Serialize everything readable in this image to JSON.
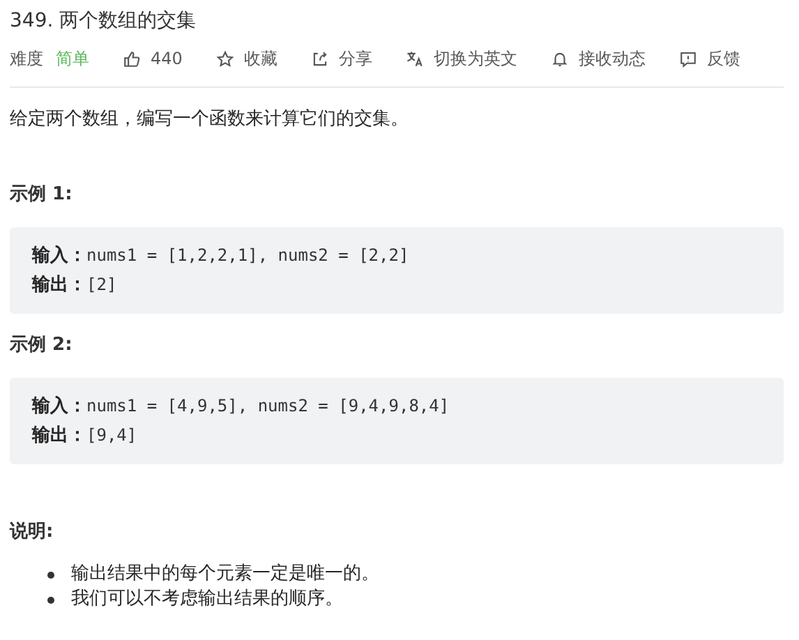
{
  "title": "349. 两个数组的交集",
  "meta": {
    "difficulty_label": "难度",
    "difficulty": {
      "text": "简单",
      "kind": "easy"
    },
    "actions": [
      {
        "kind": "like",
        "label": "440"
      },
      {
        "kind": "star",
        "label": "收藏"
      },
      {
        "kind": "share",
        "label": "分享"
      },
      {
        "kind": "translate",
        "label": "切换为英文"
      },
      {
        "kind": "bell",
        "label": "接收动态"
      },
      {
        "kind": "feedback",
        "label": "反馈"
      }
    ]
  },
  "description": "给定两个数组，编写一个函数来计算它们的交集。",
  "examples": [
    {
      "heading": "示例 1:",
      "lines": [
        {
          "label": "输入：",
          "code": "nums1 = [1,2,2,1], nums2 = [2,2]"
        },
        {
          "label": "输出：",
          "code": "[2]"
        }
      ]
    },
    {
      "heading": "示例 2:",
      "lines": [
        {
          "label": "输入：",
          "code": "nums1 = [4,9,5], nums2 = [9,4,9,8,4]"
        },
        {
          "label": "输出：",
          "code": "[9,4]"
        }
      ]
    }
  ],
  "notes": {
    "heading": "说明:",
    "items": [
      "输出结果中的每个元素一定是唯一的。",
      "我们可以不考虑输出结果的顺序。"
    ]
  }
}
